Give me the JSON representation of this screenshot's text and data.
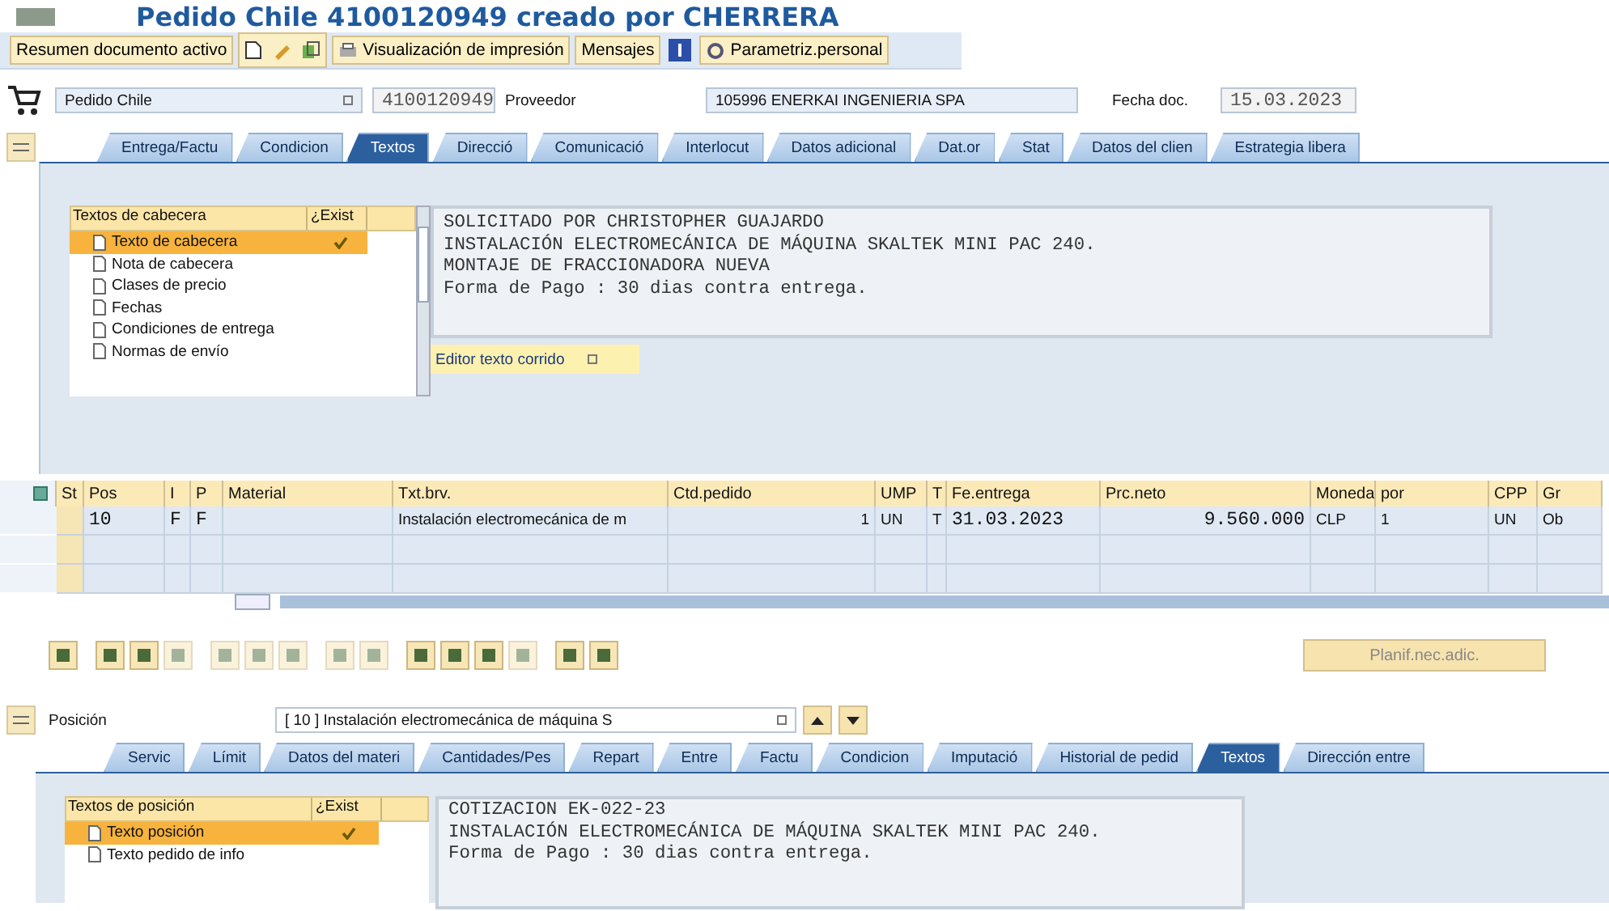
{
  "window": {
    "title": "Pedido Chile 4100120949 creado por CHERRERA"
  },
  "toolbar": [
    {
      "kind": "text",
      "label": "Resumen documento activo"
    },
    {
      "kind": "icons"
    },
    {
      "kind": "print",
      "label": "Visualización de impresión"
    },
    {
      "kind": "text",
      "label": "Mensajes"
    },
    {
      "kind": "info"
    },
    {
      "kind": "settings",
      "label": "Parametriz.personal"
    }
  ],
  "header": {
    "doc_type": "Pedido Chile",
    "number": "4100120949",
    "vendor_label": "Proveedor",
    "vendor": "105996 ENERKAI INGENIERIA SPA",
    "date_label": "Fecha doc.",
    "date": "15.03.2023"
  },
  "header_tabs": [
    {
      "label": "Entrega/Factu",
      "selected": false
    },
    {
      "label": "Condicion",
      "selected": false
    },
    {
      "label": "Textos",
      "selected": true
    },
    {
      "label": "Direcció",
      "selected": false
    },
    {
      "label": "Comunicació",
      "selected": false
    },
    {
      "label": "Interlocut",
      "selected": false
    },
    {
      "label": "Datos adicional",
      "selected": false
    },
    {
      "label": "Dat.or",
      "selected": false
    },
    {
      "label": "Stat",
      "selected": false
    },
    {
      "label": "Datos del clien",
      "selected": false
    },
    {
      "label": "Estrategia libera",
      "selected": false
    }
  ],
  "header_texts": {
    "list_title": "Textos de cabecera",
    "exist_title": "¿Exist",
    "items": [
      {
        "label": "Texto de cabecera",
        "exists": true,
        "selected": true
      },
      {
        "label": "Nota de cabecera",
        "exists": false,
        "selected": false
      },
      {
        "label": "Clases de precio",
        "exists": false,
        "selected": false
      },
      {
        "label": "Fechas",
        "exists": false,
        "selected": false
      },
      {
        "label": "Condiciones de entrega",
        "exists": false,
        "selected": false
      },
      {
        "label": "Normas de envío",
        "exists": false,
        "selected": false
      }
    ],
    "editor_lines": [
      "SOLICITADO POR CHRISTOPHER GUAJARDO",
      "INSTALACIÓN ELECTROMECÁNICA DE MÁQUINA SKALTEK MINI PAC 240.",
      "MONTAJE DE FRACCIONADORA NUEVA",
      "Forma de Pago : 30 dias contra entrega."
    ],
    "editor_mode": "Editor texto corrido"
  },
  "items_table": {
    "columns": [
      "St",
      "Pos",
      "I",
      "P",
      "Material",
      "Txt.brv.",
      "Ctd.pedido",
      "UMP",
      "T",
      "Fe.entrega",
      "Prc.neto",
      "Moneda",
      "por",
      "CPP",
      "Gr"
    ],
    "rows": [
      [
        "",
        "10",
        "F",
        "F",
        "",
        "Instalación electromecánica de m",
        "1",
        "UN",
        "T",
        "31.03.2023",
        "9.560.000",
        "CLP",
        "1",
        "UN",
        "Ob"
      ]
    ]
  },
  "extra_button": "Planif.nec.adic.",
  "position": {
    "label": "Posición",
    "value": "[ 10 ] Instalación electromecánica de máquina S"
  },
  "item_tabs": [
    {
      "label": "Servic",
      "selected": false
    },
    {
      "label": "Límit",
      "selected": false
    },
    {
      "label": "Datos del materi",
      "selected": false
    },
    {
      "label": "Cantidades/Pes",
      "selected": false
    },
    {
      "label": "Repart",
      "selected": false
    },
    {
      "label": "Entre",
      "selected": false
    },
    {
      "label": "Factu",
      "selected": false
    },
    {
      "label": "Condicion",
      "selected": false
    },
    {
      "label": "Imputació",
      "selected": false
    },
    {
      "label": "Historial de pedid",
      "selected": false
    },
    {
      "label": "Textos",
      "selected": true
    },
    {
      "label": "Dirección entre",
      "selected": false
    }
  ],
  "item_texts": {
    "list_title": "Textos de posición",
    "exist_title": "¿Exist",
    "items": [
      {
        "label": "Texto posición",
        "exists": true,
        "selected": true
      },
      {
        "label": "Texto pedido de info",
        "exists": false,
        "selected": false
      }
    ],
    "editor_lines": [
      "COTIZACION EK-022-23",
      "INSTALACIÓN ELECTROMECÁNICA DE MÁQUINA SKALTEK MINI PAC 240.",
      "Forma de Pago : 30 dias contra entrega."
    ]
  }
}
